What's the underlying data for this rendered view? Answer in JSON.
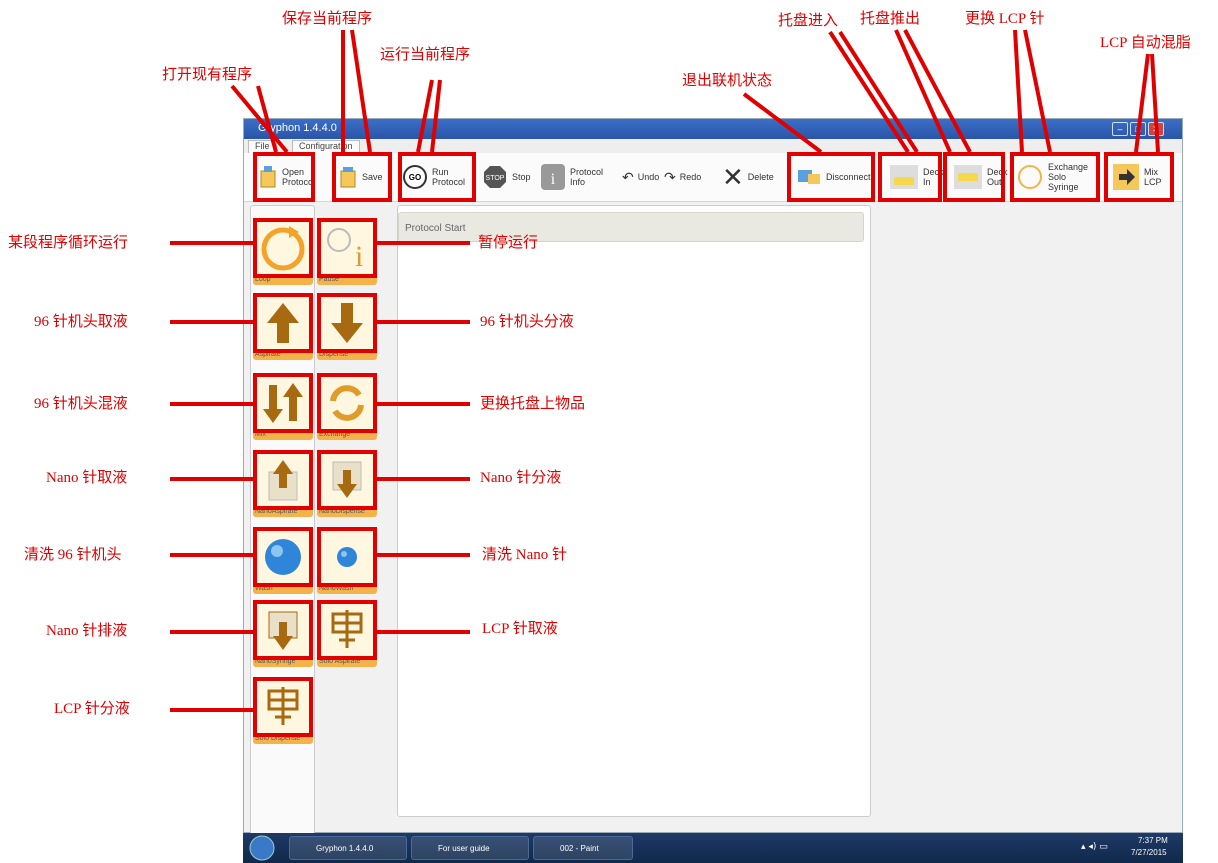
{
  "window": {
    "title": "Gryphon 1.4.4.0",
    "tabs": [
      "File",
      "Configuration"
    ]
  },
  "toolbar": {
    "open": "Open Protocol",
    "save": "Save",
    "run": "Run Protocol",
    "stop": "Stop",
    "info": "Protocol Info",
    "undo": "Undo",
    "redo": "Redo",
    "delete": "Delete",
    "disconnect": "Disconnect",
    "deck_in": "Deck In",
    "deck_out": "Deck Out",
    "exchange": "Exchange Solo Syringe",
    "mix": "Mix LCP"
  },
  "protocol": {
    "start": "Protocol Start"
  },
  "tools": [
    {
      "caption": "Loop"
    },
    {
      "caption": "Pause"
    },
    {
      "caption": "Aspirate"
    },
    {
      "caption": "Dispense"
    },
    {
      "caption": "Mix"
    },
    {
      "caption": "Exchange"
    },
    {
      "caption": "NanoAspirate"
    },
    {
      "caption": "NanoDispense"
    },
    {
      "caption": "Wash"
    },
    {
      "caption": "NanoWash"
    },
    {
      "caption": "NanoSyringe"
    },
    {
      "caption": "Solo Aspirate"
    },
    {
      "caption": "Solo Dispense"
    }
  ],
  "annotations": {
    "open": "打开现有程序",
    "save": "保存当前程序",
    "run": "运行当前程序",
    "disconnect": "退出联机状态",
    "deck_in": "托盘进入",
    "deck_out": "托盘推出",
    "exchange": "更换 LCP 针",
    "mix": "LCP 自动混脂",
    "loop": "某段程序循环运行",
    "pause": "暂停运行",
    "aspirate": "96 针机头取液",
    "dispense": "96 针机头分液",
    "mix96": "96 针机头混液",
    "exchange_deck": "更换托盘上物品",
    "nano_aspirate": "Nano 针取液",
    "nano_dispense": "Nano 针分液",
    "wash": "清洗 96 针机头",
    "nano_wash": "清洗 Nano 针",
    "nano_syringe": "Nano 针排液",
    "solo_aspirate": "LCP 针取液",
    "solo_dispense": "LCP 针分液"
  },
  "taskbar": {
    "items": [
      "Gryphon 1.4.4.0",
      "For user guide",
      "002 - Paint"
    ],
    "time": "7:37 PM",
    "date": "7/27/2015"
  },
  "colors": {
    "accent": "#e00000",
    "tile": "#f3b34a",
    "titlebar": "#2a55a8"
  }
}
